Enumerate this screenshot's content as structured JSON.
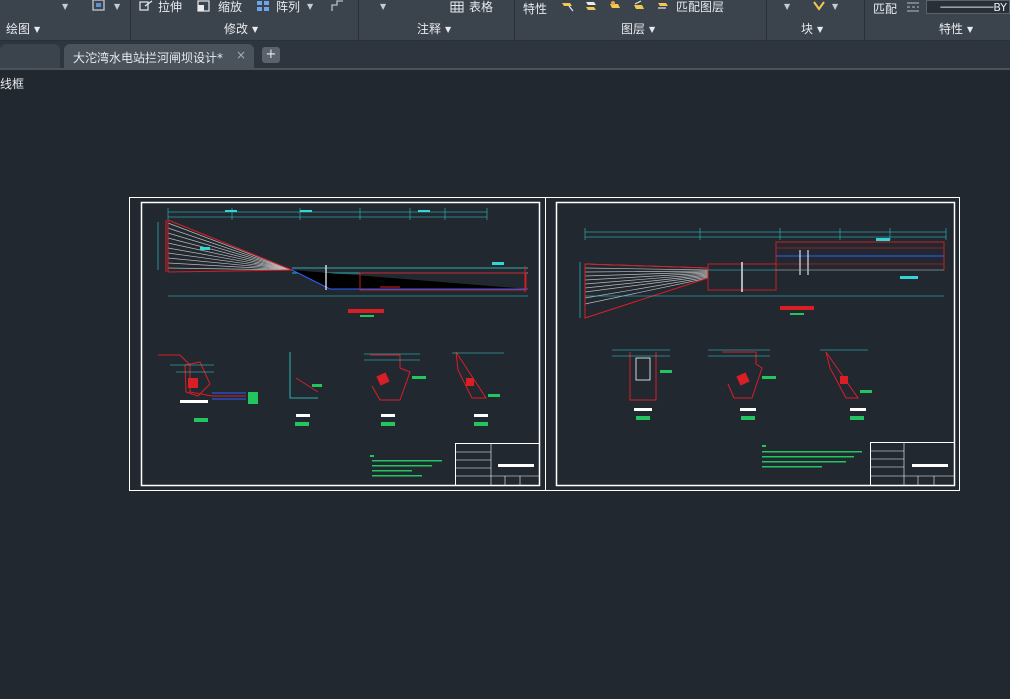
{
  "ribbon": {
    "tools": {
      "stretch": "拉伸",
      "scale": "缩放",
      "array": "阵列",
      "table": "表格",
      "properties": "特性",
      "match_layer": "匹配图层",
      "match": "匹配",
      "bylayer": "BY"
    },
    "groups": {
      "draw": "绘图",
      "modify": "修改",
      "annotation": "注释",
      "layers": "图层",
      "block": "块",
      "properties": "特性"
    }
  },
  "tabs": {
    "active_file": "大沱湾水电站拦河闸坝设计*",
    "close": "×",
    "new": "+"
  },
  "viewport": {
    "label": "线框"
  },
  "colors": {
    "background": "#212830",
    "ribbon": "#3b434d",
    "red": "#d81f26",
    "cyan": "#33d6d6",
    "green": "#22c55e",
    "blue": "#2f5fff",
    "white": "#ffffff"
  }
}
